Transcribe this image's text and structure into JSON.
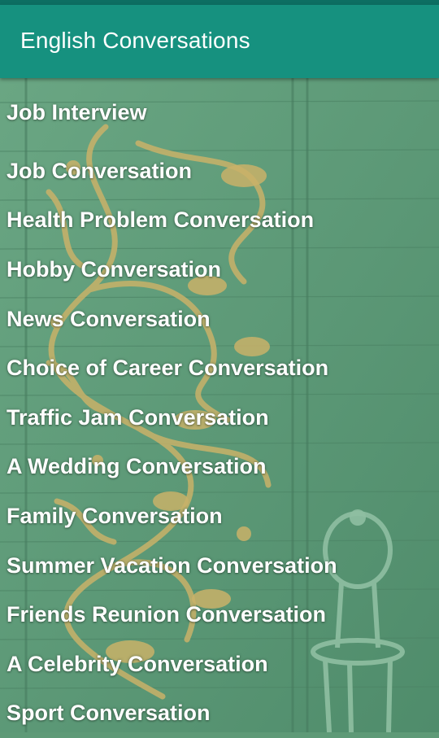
{
  "app_bar": {
    "title": "English Conversations",
    "color": "#16917f"
  },
  "background": {
    "description_icon": "ornate-wall-with-chair-image",
    "wall_color": "#5e9a77",
    "ornament_color": "#c9b269"
  },
  "conversations": [
    {
      "label": "Job Interview"
    },
    {
      "label": "Job Conversation"
    },
    {
      "label": "Health Problem Conversation"
    },
    {
      "label": "Hobby Conversation"
    },
    {
      "label": "News Conversation"
    },
    {
      "label": "Choice of Career Conversation"
    },
    {
      "label": "Traffic Jam Conversation"
    },
    {
      "label": "A Wedding Conversation"
    },
    {
      "label": "Family Conversation"
    },
    {
      "label": "Summer Vacation Conversation"
    },
    {
      "label": "Friends Reunion Conversation"
    },
    {
      "label": "A Celebrity Conversation"
    },
    {
      "label": "Sport Conversation"
    }
  ]
}
